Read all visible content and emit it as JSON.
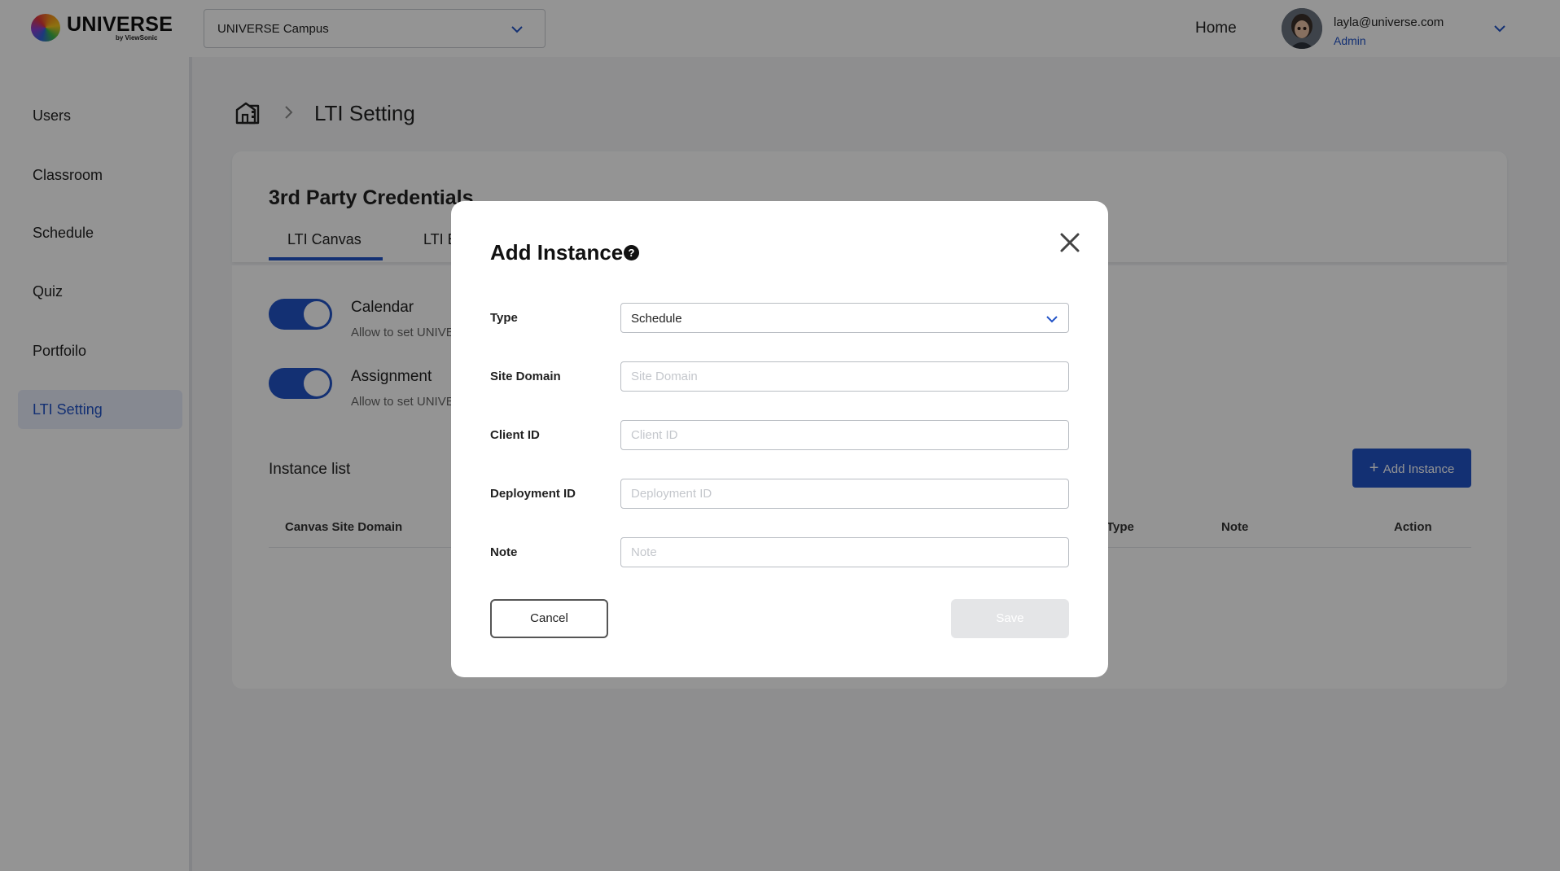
{
  "topbar": {
    "logo_text": "UNIVERSE",
    "logo_sub": "by ViewSonic",
    "campus": "UNIVERSE Campus",
    "home_label": "Home",
    "user_email": "layla@universe.com",
    "user_role": "Admin"
  },
  "sidebar": {
    "items": [
      {
        "label": "Users"
      },
      {
        "label": "Classroom"
      },
      {
        "label": "Schedule"
      },
      {
        "label": "Quiz"
      },
      {
        "label": "Portfoilo"
      },
      {
        "label": "LTI Setting",
        "active": true
      }
    ]
  },
  "breadcrumb": {
    "current": "LTI Setting"
  },
  "card": {
    "title": "3rd Party Credentials",
    "tabs": [
      {
        "label": "LTI Canvas",
        "active": true
      },
      {
        "label": "LTI B"
      }
    ],
    "toggles": [
      {
        "title": "Calendar",
        "desc": "Allow to set UNIVE",
        "on": true
      },
      {
        "title": "Assignment",
        "desc": "Allow to set UNIVE",
        "on": true
      }
    ],
    "instance_list_title": "Instance list",
    "add_instance_label": "Add Instance",
    "table_headers": [
      "Canvas Site Domain",
      "Type",
      "Note",
      "Action"
    ]
  },
  "modal": {
    "title": "Add Instance",
    "help_glyph": "?",
    "fields": {
      "type_label": "Type",
      "type_value": "Schedule",
      "site_domain_label": "Site Domain",
      "site_domain_placeholder": "Site Domain",
      "client_id_label": "Client ID",
      "client_id_placeholder": "Client ID",
      "deployment_id_label": "Deployment ID",
      "deployment_id_placeholder": "Deployment ID",
      "note_label": "Note",
      "note_placeholder": "Note"
    },
    "cancel_label": "Cancel",
    "save_label": "Save"
  },
  "colors": {
    "accent": "#2253c7",
    "overlay": "rgba(0,0,0,0.42)",
    "disabled_button": "#e4e5e7"
  },
  "icons": [
    "home-building-icon",
    "chevron-right-icon",
    "chevron-down-icon",
    "help-icon",
    "close-icon",
    "plus-icon"
  ]
}
